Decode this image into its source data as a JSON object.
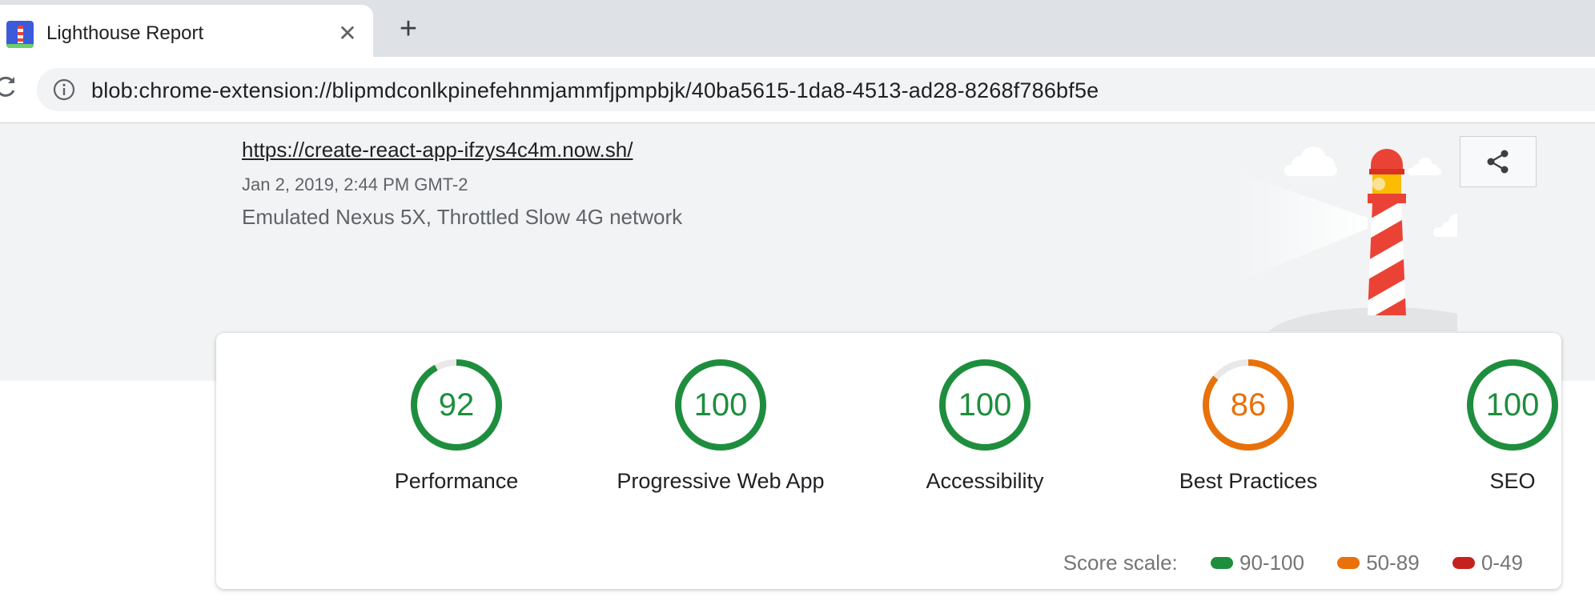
{
  "browser": {
    "tab_title": "Lighthouse Report",
    "tab_close_glyph": "✕",
    "new_tab_glyph": "+",
    "url": "blob:chrome-extension://blipmdconlkpinefehnmjammfjpmpbjk/40ba5615-1da8-4513-ad28-8268f786bf5e"
  },
  "report": {
    "url": "https://create-react-app-ifzys4c4m.now.sh/",
    "date": "Jan 2, 2019, 2:44 PM GMT-2",
    "environment": "Emulated Nexus 5X, Throttled Slow 4G network"
  },
  "scores": [
    {
      "value": 92,
      "label": "Performance",
      "rating": "pass"
    },
    {
      "value": 100,
      "label": "Progressive Web App",
      "rating": "pass"
    },
    {
      "value": 100,
      "label": "Accessibility",
      "rating": "pass"
    },
    {
      "value": 86,
      "label": "Best Practices",
      "rating": "average"
    },
    {
      "value": 100,
      "label": "SEO",
      "rating": "pass"
    }
  ],
  "score_scale": {
    "label": "Score scale:",
    "ranges": [
      {
        "label": "90-100",
        "color": "#1e8e3e"
      },
      {
        "label": "50-89",
        "color": "#e8710a"
      },
      {
        "label": "0-49",
        "color": "#c5221f"
      }
    ]
  },
  "colors": {
    "pass": "#1e8e3e",
    "average": "#e8710a",
    "fail": "#c5221f",
    "gauge_track": "#e8e8e8"
  },
  "icons": {
    "favicon": "lighthouse-favicon-icon",
    "reload": "reload-icon",
    "info": "info-icon",
    "share": "share-icon"
  }
}
